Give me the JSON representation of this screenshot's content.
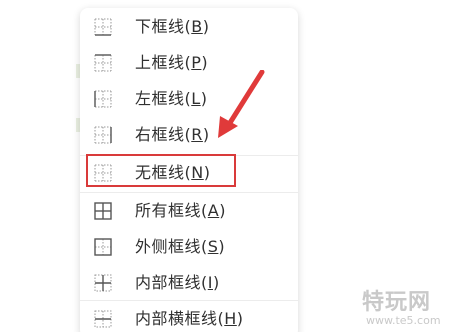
{
  "menu": {
    "items": [
      {
        "text": "下框线",
        "key": "B",
        "icon": "border-bottom-icon",
        "name": "menu-item-bottom-border"
      },
      {
        "text": "上框线",
        "key": "P",
        "icon": "border-top-icon",
        "name": "menu-item-top-border"
      },
      {
        "text": "左框线",
        "key": "L",
        "icon": "border-left-icon",
        "name": "menu-item-left-border"
      },
      {
        "text": "右框线",
        "key": "R",
        "icon": "border-right-icon",
        "name": "menu-item-right-border"
      },
      {
        "text": "无框线",
        "key": "N",
        "icon": "border-none-icon",
        "name": "menu-item-no-border"
      },
      {
        "text": "所有框线",
        "key": "A",
        "icon": "border-all-icon",
        "name": "menu-item-all-borders"
      },
      {
        "text": "外侧框线",
        "key": "S",
        "icon": "border-outside-icon",
        "name": "menu-item-outside-borders"
      },
      {
        "text": "内部框线",
        "key": "I",
        "icon": "border-inside-icon",
        "name": "menu-item-inside-borders"
      },
      {
        "text": "内部横框线",
        "key": "H",
        "icon": "border-inside-horizontal-icon",
        "name": "menu-item-inside-horizontal-border"
      }
    ]
  },
  "annotation": {
    "highlight_color": "#d93a3a",
    "arrow_color": "#e03a3a"
  },
  "watermark": {
    "title": "特玩网",
    "url": "www.te5.com"
  }
}
